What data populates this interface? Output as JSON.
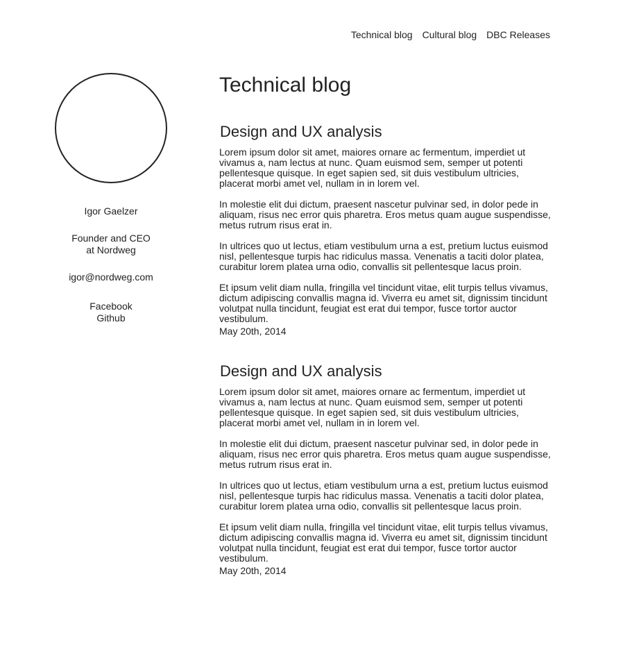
{
  "nav": {
    "items": [
      "Technical blog",
      "Cultural blog",
      "DBC Releases"
    ]
  },
  "profile": {
    "name": "Igor Gaelzer",
    "role_line1": "Founder and CEO",
    "role_line2": "at Nordweg",
    "email": "igor@nordweg.com",
    "links": [
      "Facebook",
      "Github"
    ]
  },
  "main": {
    "title": "Technical blog",
    "posts": [
      {
        "title": "Design and UX analysis",
        "paragraphs": [
          "Lorem ipsum dolor sit amet, maiores ornare ac fermentum, imperdiet ut vivamus a, nam lectus at nunc. Quam euismod sem, semper ut potenti pellentesque quisque. In eget sapien sed, sit duis vestibulum ultricies, placerat morbi amet vel, nullam in in lorem vel.",
          "In molestie elit dui dictum, praesent nascetur pulvinar sed, in dolor pede in aliquam, risus nec error quis pharetra. Eros metus quam augue suspendisse, metus rutrum risus erat in.",
          "In ultrices quo ut lectus, etiam vestibulum urna a est, pretium luctus euismod nisl, pellentesque turpis hac ridiculus massa. Venenatis a taciti dolor platea, curabitur lorem platea urna odio, convallis sit pellentesque lacus proin.",
          "Et ipsum velit diam nulla, fringilla vel tincidunt vitae, elit turpis tellus vivamus, dictum adipiscing convallis magna id. Viverra eu amet sit, dignissim tincidunt volutpat nulla tincidunt, feugiat est erat dui tempor, fusce tortor auctor vestibulum."
        ],
        "date": "May 20th, 2014"
      },
      {
        "title": "Design and UX analysis",
        "paragraphs": [
          "Lorem ipsum dolor sit amet, maiores ornare ac fermentum, imperdiet ut vivamus a, nam lectus at nunc. Quam euismod sem, semper ut potenti pellentesque quisque. In eget sapien sed, sit duis vestibulum ultricies, placerat morbi amet vel, nullam in in lorem vel.",
          "In molestie elit dui dictum, praesent nascetur pulvinar sed, in dolor pede in aliquam, risus nec error quis pharetra. Eros metus quam augue suspendisse, metus rutrum risus erat in.",
          "In ultrices quo ut lectus, etiam vestibulum urna a est, pretium luctus euismod nisl, pellentesque turpis hac ridiculus massa. Venenatis a taciti dolor platea, curabitur lorem platea urna odio, convallis sit pellentesque lacus proin.",
          "Et ipsum velit diam nulla, fringilla vel tincidunt vitae, elit turpis tellus vivamus, dictum adipiscing convallis magna id. Viverra eu amet sit, dignissim tincidunt volutpat nulla tincidunt, feugiat est erat dui tempor, fusce tortor auctor vestibulum."
        ],
        "date": "May 20th, 2014"
      }
    ]
  }
}
